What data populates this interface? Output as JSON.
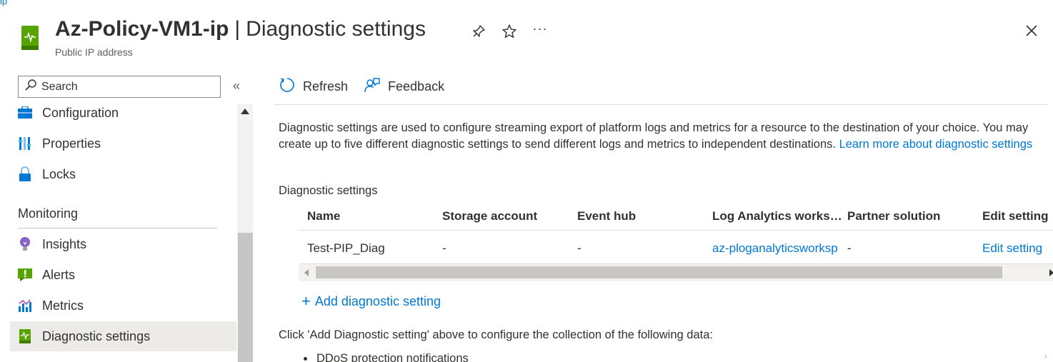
{
  "breadcrumb_fragment": "ip",
  "header": {
    "resource_name": "Az-Policy-VM1-ip",
    "separator": "|",
    "page_title": "Diagnostic settings",
    "resource_type": "Public IP address",
    "icons": [
      "public-ip-icon",
      "pin-icon",
      "star-icon",
      "more-icon",
      "close-icon"
    ],
    "more_label": "···"
  },
  "sidebar": {
    "search_placeholder": "Search",
    "collapse_glyph": "«",
    "items": [
      {
        "label": "Configuration",
        "icon": "configuration-icon"
      },
      {
        "label": "Properties",
        "icon": "properties-icon"
      },
      {
        "label": "Locks",
        "icon": "lock-icon"
      }
    ],
    "section": "Monitoring",
    "monitoring_items": [
      {
        "label": "Insights",
        "icon": "insights-icon"
      },
      {
        "label": "Alerts",
        "icon": "alerts-icon"
      },
      {
        "label": "Metrics",
        "icon": "metrics-icon"
      },
      {
        "label": "Diagnostic settings",
        "icon": "diagnostic-settings-icon",
        "active": true
      }
    ]
  },
  "toolbar": {
    "refresh_label": "Refresh",
    "feedback_label": "Feedback"
  },
  "main": {
    "description_text": "Diagnostic settings are used to configure streaming export of platform logs and metrics for a resource to the destination of your choice. You may create up to five different diagnostic settings to send different logs and metrics to independent destinations. ",
    "learn_more_link": "Learn more about diagnostic settings",
    "section_label": "Diagnostic settings",
    "table": {
      "columns": [
        "Name",
        "Storage account",
        "Event hub",
        "Log Analytics works…",
        "Partner solution",
        "Edit setting"
      ],
      "rows": [
        [
          "Test-PIP_Diag",
          "-",
          "-",
          "az-ploganalyticsworksp",
          "-",
          "Edit setting"
        ]
      ]
    },
    "add_plus": "+",
    "add_label": "Add diagnostic setting",
    "click_note": "Click 'Add Diagnostic setting' above to configure the collection of the following data:",
    "data_items": [
      "DDoS protection notifications"
    ]
  },
  "colors": {
    "accent": "#0078d4",
    "resource_icon_green": "#57a300",
    "active_nav_bg": "#edebe9"
  }
}
